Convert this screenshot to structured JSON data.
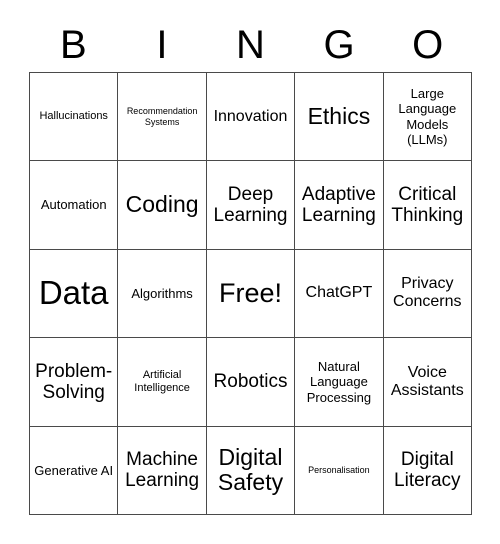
{
  "card": {
    "title": "Bingo Card",
    "header_letters": [
      "B",
      "I",
      "N",
      "G",
      "O"
    ],
    "colors": {
      "background": "#ffffff",
      "text": "#000000",
      "grid_line": "#4a4a4a"
    },
    "grid": {
      "columns": 5,
      "rows": 5,
      "cells": [
        {
          "text": "Hallucinations",
          "size": "sm"
        },
        {
          "text": "Recommendation Systems",
          "size": "xs"
        },
        {
          "text": "Innovation",
          "size": "lg"
        },
        {
          "text": "Ethics",
          "size": "2xl"
        },
        {
          "text": "Large Language Models (LLMs)",
          "size": "md"
        },
        {
          "text": "Automation",
          "size": "md"
        },
        {
          "text": "Coding",
          "size": "2xl"
        },
        {
          "text": "Deep Learning",
          "size": "xl"
        },
        {
          "text": "Adaptive Learning",
          "size": "xl"
        },
        {
          "text": "Critical Thinking",
          "size": "xl"
        },
        {
          "text": "Data",
          "size": "4xl"
        },
        {
          "text": "Algorithms",
          "size": "md"
        },
        {
          "text": "Free!",
          "size": "3xl"
        },
        {
          "text": "ChatGPT",
          "size": "lg"
        },
        {
          "text": "Privacy Concerns",
          "size": "lg"
        },
        {
          "text": "Problem-Solving",
          "size": "xl"
        },
        {
          "text": "Artificial Intelligence",
          "size": "sm"
        },
        {
          "text": "Robotics",
          "size": "xl"
        },
        {
          "text": "Natural Language Processing",
          "size": "md"
        },
        {
          "text": "Voice Assistants",
          "size": "lg"
        },
        {
          "text": "Generative AI",
          "size": "md"
        },
        {
          "text": "Machine Learning",
          "size": "xl"
        },
        {
          "text": "Digital Safety",
          "size": "2xl"
        },
        {
          "text": "Personalisation",
          "size": "xs"
        },
        {
          "text": "Digital Literacy",
          "size": "xl"
        }
      ]
    }
  }
}
